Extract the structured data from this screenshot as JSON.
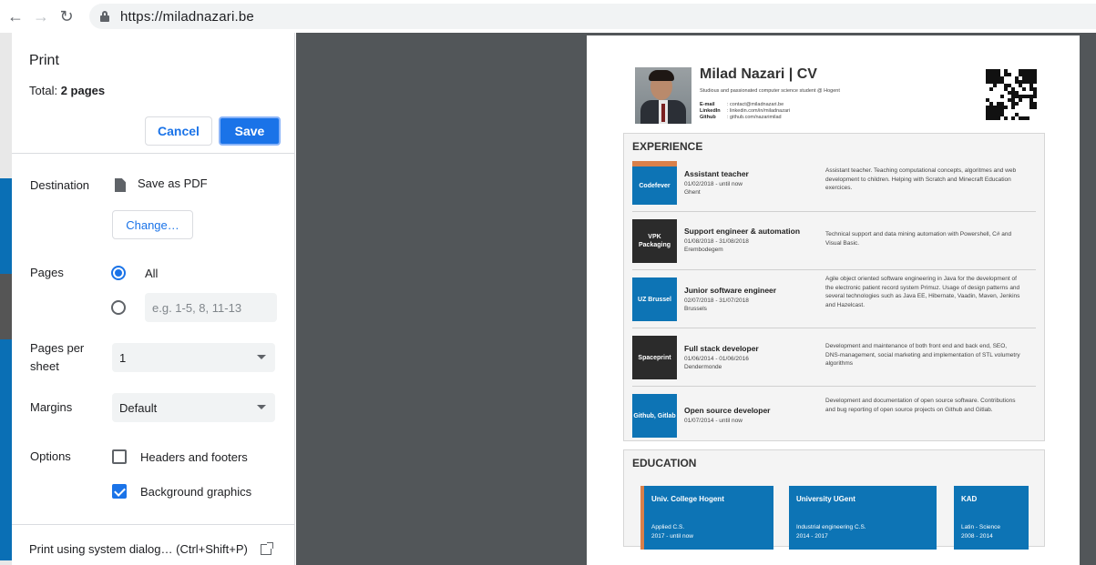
{
  "browser": {
    "url": "https://miladnazari.be"
  },
  "print_dialog": {
    "title": "Print",
    "total_label": "Total:",
    "total_value": "2 pages",
    "cancel_label": "Cancel",
    "save_label": "Save",
    "destination_label": "Destination",
    "destination_value": "Save as PDF",
    "change_label": "Change…",
    "pages_label": "Pages",
    "pages_all_label": "All",
    "pages_all_selected": true,
    "pages_custom_placeholder": "e.g. 1-5, 8, 11-13",
    "pages_per_sheet_label": "Pages per sheet",
    "pages_per_sheet_value": "1",
    "margins_label": "Margins",
    "margins_value": "Default",
    "options_label": "Options",
    "headers_footers_label": "Headers and footers",
    "headers_footers_checked": false,
    "background_graphics_label": "Background graphics",
    "background_graphics_checked": true,
    "system_dialog_label": "Print using system dialog… (Ctrl+Shift+P)"
  },
  "cv": {
    "name": "Milad Nazari | CV",
    "tagline": "Studious and passionated computer science student @ Hogent",
    "contacts": [
      {
        "key": "E-mail",
        "value": ": contact@miladnazari.be"
      },
      {
        "key": "LinkedIn",
        "value": ": linkedin.com/in/miladnazari"
      },
      {
        "key": "Github",
        "value": ": github.com/nazarimilad"
      }
    ],
    "experience_title": "EXPERIENCE",
    "experience": [
      {
        "badge": "Codefever",
        "badge_color": "#0d74b5",
        "title": "Assistant teacher",
        "dates": "01/02/2018 - until now",
        "location": "Ghent",
        "description": "Assistant teacher. Teaching computational concepts, algoritmes and web development to children. Helping with Scratch and Minecraft Education exercices."
      },
      {
        "badge": "VPK Packaging",
        "badge_color": "#2b2b2b",
        "title": "Support engineer & automation",
        "dates": "01/08/2018 - 31/08/2018",
        "location": "Erembodegem",
        "description": "Technical support and data mining automation with Powershell, C# and Visual Basic."
      },
      {
        "badge": "UZ Brussel",
        "badge_color": "#0d74b5",
        "title": "Junior software engineer",
        "dates": "02/07/2018 - 31/07/2018",
        "location": "Brussels",
        "description": "Agile object oriented software engineering in Java for the development of the electronic patient record system Primuz. Usage of design patterns and several technologies such as Java EE, Hibernate, Vaadin, Maven, Jenkins and Hazelcast."
      },
      {
        "badge": "Spaceprint",
        "badge_color": "#2b2b2b",
        "title": "Full stack developer",
        "dates": "01/06/2014 - 01/06/2016",
        "location": "Dendermonde",
        "description": "Development and maintenance of both front end and back end, SEO, DNS-management, social marketing and implementation of STL volumetry algorithms"
      },
      {
        "badge": "Github, Gitlab",
        "badge_color": "#0d74b5",
        "title": "Open source developer",
        "dates": "01/07/2014 - until now",
        "location": "",
        "description": "Development and documentation of open source software. Contributions and bug reporting of open source projects on Github and Gitlab."
      }
    ],
    "education_title": "EDUCATION",
    "education": [
      {
        "name": "Univ. College Hogent",
        "field": "Applied C.S.",
        "years": "2017 - until now"
      },
      {
        "name": "University UGent",
        "field": "Industrial engineering C.S.",
        "years": "2014 - 2017"
      },
      {
        "name": "KAD",
        "field": "Latin - Science",
        "years": "2008 - 2014"
      }
    ],
    "accent_color": "#d9804a",
    "primary_color": "#0d74b5"
  }
}
